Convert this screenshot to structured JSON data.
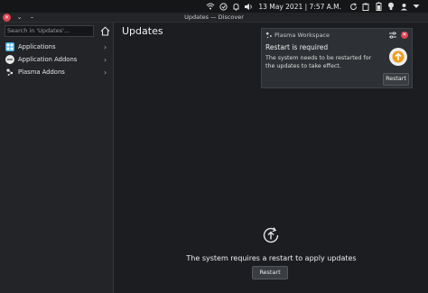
{
  "panel": {
    "datetime": "13 May 2021 | 7:57 A.M.",
    "icons": [
      "wifi-icon",
      "notifications-icon",
      "bell-icon",
      "volume-icon",
      "clock-icon",
      "clipboard-icon",
      "sync-icon",
      "battery-icon",
      "bulb-icon",
      "user-icon",
      "menu-down-icon"
    ]
  },
  "window": {
    "title": "Updates — Discover"
  },
  "sidebar": {
    "search_placeholder": "Search in 'Updates'...",
    "categories": [
      {
        "label": "Applications",
        "icon": "applications-icon"
      },
      {
        "label": "Application Addons",
        "icon": "addons-icon"
      },
      {
        "label": "Plasma Addons",
        "icon": "plasma-icon"
      }
    ]
  },
  "main": {
    "heading": "Updates",
    "message": "The system requires a restart to apply updates",
    "restart_label": "Restart"
  },
  "notification": {
    "app": "Plasma Workspace",
    "title": "Restart is required",
    "body": "The system needs to be restarted for the updates to take effect.",
    "button": "Restart",
    "accent": "#f39c1f"
  }
}
